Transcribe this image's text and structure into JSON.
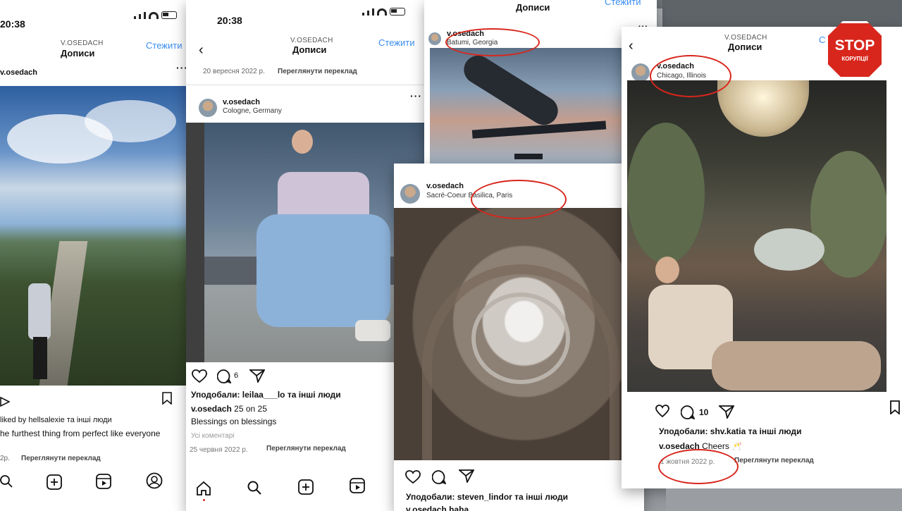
{
  "cards": {
    "left": {
      "time": "20:38",
      "account": "V.OSEDACH",
      "title": "Дописи",
      "follow": "Стежити",
      "username": "v.osedach",
      "liked_by": "liked by hellsalexie та інші люди",
      "caption": "he furthest thing from perfect like everyone",
      "see_translation": "Переглянути переклад",
      "date_prefix": "2р."
    },
    "cologne": {
      "time": "20:38",
      "account": "V.OSEDACH",
      "title": "Дописи",
      "follow": "Стежити",
      "prev_date": "20 вересня 2022 р.",
      "prev_translation": "Переглянути переклад",
      "username": "v.osedach",
      "location": "Cologne, Germany",
      "comments_count": "6",
      "liked_by": "Уподобали: leilaa___lo та інші люди",
      "caption_user": "v.osedach",
      "caption": "25 on 25",
      "caption2": "Blessings on blessings",
      "all_comments": "Усі коментарі",
      "date": "25 червня 2022 р.",
      "see_translation": "Переглянути переклад"
    },
    "batumi": {
      "title": "Дописи",
      "follow": "Стежити",
      "username": "v.osedach",
      "location": "Batumi, Georgia"
    },
    "paris": {
      "username": "v.osedach",
      "location": "Sacré-Coeur Basilica, Paris",
      "liked_by": "Уподобали: steven_lindor та інші люди",
      "caption": "v.osedach haha"
    },
    "chicago": {
      "account": "V.OSEDACH",
      "title": "Дописи",
      "follow": "Сте",
      "username": "v.osedach",
      "location": "Chicago, Illinois",
      "comments_count": "10",
      "liked_by": "Уподобали: shv.katia та інші люди",
      "caption_user": "v.osedach",
      "caption": "Cheers 🥂",
      "date": "1 жовтня 2022 р.",
      "see_translation": "Переглянути переклад"
    }
  },
  "badge": {
    "word": "STOP",
    "sub": "КОРУПЦІЇ"
  },
  "colors": {
    "accent_blue": "#3a8ef0",
    "highlight_red": "#d8261c"
  },
  "icons": [
    "heart-icon",
    "comment-icon",
    "share-icon",
    "bookmark-icon",
    "home-icon",
    "search-icon",
    "add-post-icon",
    "reels-icon",
    "profile-icon",
    "back-arrow-icon",
    "more-icon",
    "mute-icon"
  ]
}
